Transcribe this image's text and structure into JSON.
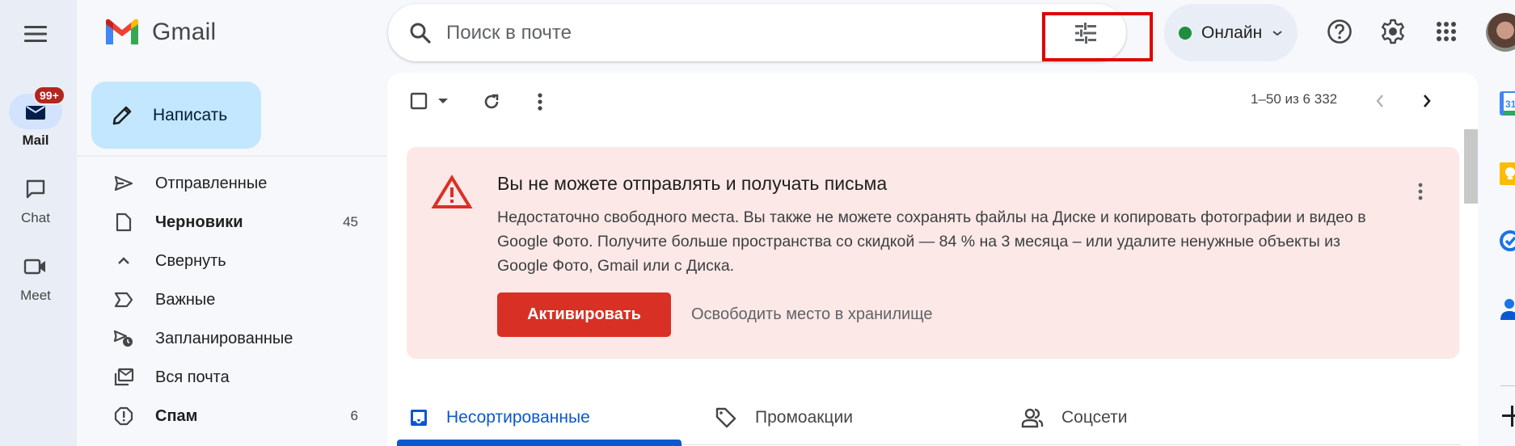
{
  "app": {
    "name": "Gmail"
  },
  "rail": {
    "items": [
      {
        "label": "Mail",
        "badge": "99+",
        "active": true
      },
      {
        "label": "Chat"
      },
      {
        "label": "Meet"
      }
    ]
  },
  "compose": {
    "label": "Написать"
  },
  "sidebar": {
    "items": [
      {
        "label": "Отправленные",
        "icon": "send-icon",
        "count": ""
      },
      {
        "label": "Черновики",
        "icon": "draft-icon",
        "count": "45",
        "bold": true
      },
      {
        "label": "Свернуть",
        "icon": "chevron-up-icon",
        "count": ""
      },
      {
        "label": "Важные",
        "icon": "important-icon",
        "count": ""
      },
      {
        "label": "Запланированные",
        "icon": "scheduled-icon",
        "count": ""
      },
      {
        "label": "Вся почта",
        "icon": "all-mail-icon",
        "count": ""
      },
      {
        "label": "Спам",
        "icon": "spam-icon",
        "count": "6",
        "bold": true
      }
    ]
  },
  "search": {
    "placeholder": "Поиск в почте",
    "value": ""
  },
  "status": {
    "label": "Онлайн",
    "color": "#1e8e3e"
  },
  "toolbar": {
    "pagination": "1–50 из 6 332"
  },
  "alert": {
    "title": "Вы не можете отправлять и получать письма",
    "body": "Недостаточно свободного места. Вы также не можете сохранять файлы на Диске и копировать фотографии и видео в Google Фото. Получите больше пространства со скидкой — 84 % на 3 месяца – или удалите ненужные объекты из Google Фото, Gmail или с Диска.",
    "primary_button": "Активировать",
    "secondary_link": "Освободить место в хранилище",
    "color": "#d93025"
  },
  "tabs": [
    {
      "label": "Несортированные",
      "active": true
    },
    {
      "label": "Промоакции"
    },
    {
      "label": "Соцсети"
    }
  ],
  "side_panel": {
    "calendar_day": "31"
  },
  "colors": {
    "accent": "#0b57d0",
    "compose_bg": "#c2e7ff",
    "alert_bg": "#fce8e6",
    "highlight_box": "#e00000"
  }
}
